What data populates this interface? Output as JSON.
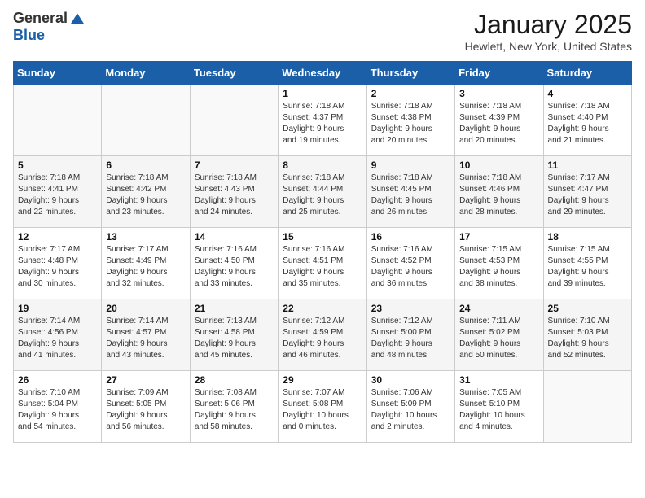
{
  "logo": {
    "general": "General",
    "blue": "Blue"
  },
  "header": {
    "month": "January 2025",
    "location": "Hewlett, New York, United States"
  },
  "weekdays": [
    "Sunday",
    "Monday",
    "Tuesday",
    "Wednesday",
    "Thursday",
    "Friday",
    "Saturday"
  ],
  "weeks": [
    [
      {
        "day": "",
        "info": ""
      },
      {
        "day": "",
        "info": ""
      },
      {
        "day": "",
        "info": ""
      },
      {
        "day": "1",
        "info": "Sunrise: 7:18 AM\nSunset: 4:37 PM\nDaylight: 9 hours\nand 19 minutes."
      },
      {
        "day": "2",
        "info": "Sunrise: 7:18 AM\nSunset: 4:38 PM\nDaylight: 9 hours\nand 20 minutes."
      },
      {
        "day": "3",
        "info": "Sunrise: 7:18 AM\nSunset: 4:39 PM\nDaylight: 9 hours\nand 20 minutes."
      },
      {
        "day": "4",
        "info": "Sunrise: 7:18 AM\nSunset: 4:40 PM\nDaylight: 9 hours\nand 21 minutes."
      }
    ],
    [
      {
        "day": "5",
        "info": "Sunrise: 7:18 AM\nSunset: 4:41 PM\nDaylight: 9 hours\nand 22 minutes."
      },
      {
        "day": "6",
        "info": "Sunrise: 7:18 AM\nSunset: 4:42 PM\nDaylight: 9 hours\nand 23 minutes."
      },
      {
        "day": "7",
        "info": "Sunrise: 7:18 AM\nSunset: 4:43 PM\nDaylight: 9 hours\nand 24 minutes."
      },
      {
        "day": "8",
        "info": "Sunrise: 7:18 AM\nSunset: 4:44 PM\nDaylight: 9 hours\nand 25 minutes."
      },
      {
        "day": "9",
        "info": "Sunrise: 7:18 AM\nSunset: 4:45 PM\nDaylight: 9 hours\nand 26 minutes."
      },
      {
        "day": "10",
        "info": "Sunrise: 7:18 AM\nSunset: 4:46 PM\nDaylight: 9 hours\nand 28 minutes."
      },
      {
        "day": "11",
        "info": "Sunrise: 7:17 AM\nSunset: 4:47 PM\nDaylight: 9 hours\nand 29 minutes."
      }
    ],
    [
      {
        "day": "12",
        "info": "Sunrise: 7:17 AM\nSunset: 4:48 PM\nDaylight: 9 hours\nand 30 minutes."
      },
      {
        "day": "13",
        "info": "Sunrise: 7:17 AM\nSunset: 4:49 PM\nDaylight: 9 hours\nand 32 minutes."
      },
      {
        "day": "14",
        "info": "Sunrise: 7:16 AM\nSunset: 4:50 PM\nDaylight: 9 hours\nand 33 minutes."
      },
      {
        "day": "15",
        "info": "Sunrise: 7:16 AM\nSunset: 4:51 PM\nDaylight: 9 hours\nand 35 minutes."
      },
      {
        "day": "16",
        "info": "Sunrise: 7:16 AM\nSunset: 4:52 PM\nDaylight: 9 hours\nand 36 minutes."
      },
      {
        "day": "17",
        "info": "Sunrise: 7:15 AM\nSunset: 4:53 PM\nDaylight: 9 hours\nand 38 minutes."
      },
      {
        "day": "18",
        "info": "Sunrise: 7:15 AM\nSunset: 4:55 PM\nDaylight: 9 hours\nand 39 minutes."
      }
    ],
    [
      {
        "day": "19",
        "info": "Sunrise: 7:14 AM\nSunset: 4:56 PM\nDaylight: 9 hours\nand 41 minutes."
      },
      {
        "day": "20",
        "info": "Sunrise: 7:14 AM\nSunset: 4:57 PM\nDaylight: 9 hours\nand 43 minutes."
      },
      {
        "day": "21",
        "info": "Sunrise: 7:13 AM\nSunset: 4:58 PM\nDaylight: 9 hours\nand 45 minutes."
      },
      {
        "day": "22",
        "info": "Sunrise: 7:12 AM\nSunset: 4:59 PM\nDaylight: 9 hours\nand 46 minutes."
      },
      {
        "day": "23",
        "info": "Sunrise: 7:12 AM\nSunset: 5:00 PM\nDaylight: 9 hours\nand 48 minutes."
      },
      {
        "day": "24",
        "info": "Sunrise: 7:11 AM\nSunset: 5:02 PM\nDaylight: 9 hours\nand 50 minutes."
      },
      {
        "day": "25",
        "info": "Sunrise: 7:10 AM\nSunset: 5:03 PM\nDaylight: 9 hours\nand 52 minutes."
      }
    ],
    [
      {
        "day": "26",
        "info": "Sunrise: 7:10 AM\nSunset: 5:04 PM\nDaylight: 9 hours\nand 54 minutes."
      },
      {
        "day": "27",
        "info": "Sunrise: 7:09 AM\nSunset: 5:05 PM\nDaylight: 9 hours\nand 56 minutes."
      },
      {
        "day": "28",
        "info": "Sunrise: 7:08 AM\nSunset: 5:06 PM\nDaylight: 9 hours\nand 58 minutes."
      },
      {
        "day": "29",
        "info": "Sunrise: 7:07 AM\nSunset: 5:08 PM\nDaylight: 10 hours\nand 0 minutes."
      },
      {
        "day": "30",
        "info": "Sunrise: 7:06 AM\nSunset: 5:09 PM\nDaylight: 10 hours\nand 2 minutes."
      },
      {
        "day": "31",
        "info": "Sunrise: 7:05 AM\nSunset: 5:10 PM\nDaylight: 10 hours\nand 4 minutes."
      },
      {
        "day": "",
        "info": ""
      }
    ]
  ]
}
